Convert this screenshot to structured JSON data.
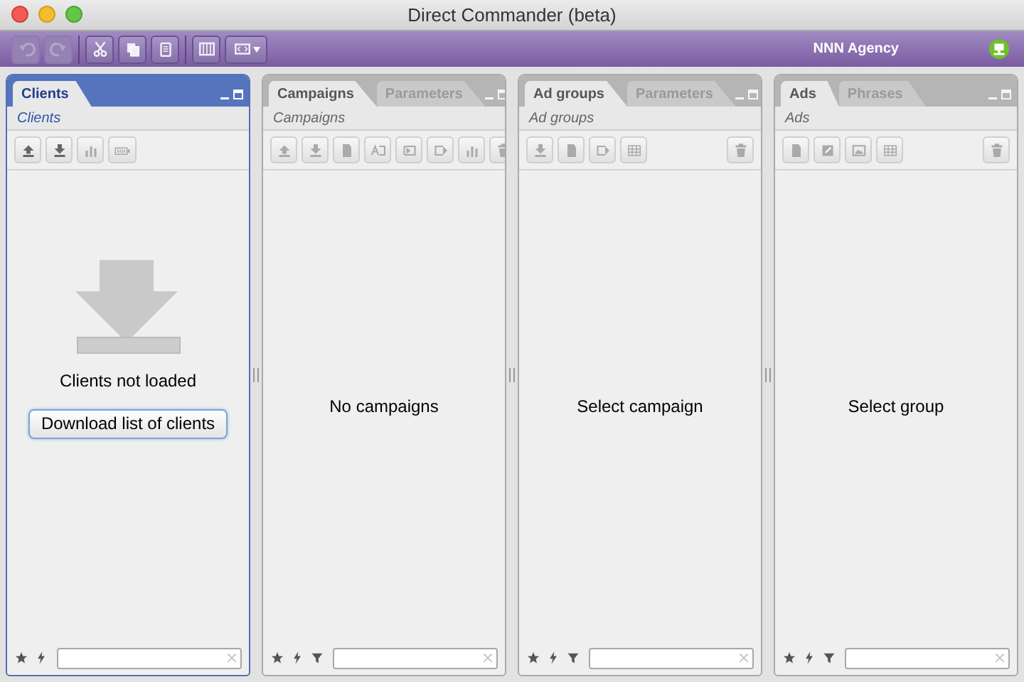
{
  "window": {
    "title": "Direct Commander (beta)"
  },
  "toolbar": {
    "buttons": [
      {
        "kind": "undo",
        "disabled": true
      },
      {
        "kind": "redo",
        "disabled": true
      },
      {
        "kind": "cut",
        "disabled": false
      },
      {
        "kind": "copy",
        "disabled": false
      },
      {
        "kind": "paste",
        "disabled": false
      },
      {
        "kind": "columns",
        "disabled": false
      },
      {
        "kind": "view",
        "disabled": false
      }
    ],
    "account": "NNN Agency"
  },
  "panels": [
    {
      "active": true,
      "tabs": [
        {
          "label": "Clients",
          "selected": true
        }
      ],
      "subtitle": "Clients",
      "tools": [
        {
          "kind": "upload"
        },
        {
          "kind": "download"
        },
        {
          "kind": "chart"
        },
        {
          "kind": "battery"
        }
      ],
      "message": "Clients not loaded",
      "illustration": true,
      "action_button": "Download list of clients",
      "filters": [
        {
          "kind": "star"
        },
        {
          "kind": "bolt"
        }
      ]
    },
    {
      "active": false,
      "tabs": [
        {
          "label": "Campaigns",
          "selected": true
        },
        {
          "label": "Parameters",
          "selected": false
        }
      ],
      "subtitle": "Campaigns",
      "tools": [
        {
          "kind": "upload"
        },
        {
          "kind": "download"
        },
        {
          "kind": "document"
        },
        {
          "kind": "ab"
        },
        {
          "kind": "bracket-in"
        },
        {
          "kind": "bracket-out"
        },
        {
          "kind": "chart"
        },
        {
          "kind": "trash"
        }
      ],
      "message": "No campaigns",
      "filters": [
        {
          "kind": "star"
        },
        {
          "kind": "bolt"
        },
        {
          "kind": "funnel"
        }
      ]
    },
    {
      "active": false,
      "tabs": [
        {
          "label": "Ad groups",
          "selected": true
        },
        {
          "label": "Parameters",
          "selected": false
        }
      ],
      "subtitle": "Ad groups",
      "tools": [
        {
          "kind": "download"
        },
        {
          "kind": "document"
        },
        {
          "kind": "bracket-out"
        },
        {
          "kind": "table"
        },
        {
          "kind": "trash"
        }
      ],
      "message": "Select campaign",
      "filters": [
        {
          "kind": "star"
        },
        {
          "kind": "bolt"
        },
        {
          "kind": "funnel"
        }
      ]
    },
    {
      "active": false,
      "tabs": [
        {
          "label": "Ads",
          "selected": true
        },
        {
          "label": "Phrases",
          "selected": false
        }
      ],
      "subtitle": "Ads",
      "tools": [
        {
          "kind": "document"
        },
        {
          "kind": "edit"
        },
        {
          "kind": "image"
        },
        {
          "kind": "table"
        },
        {
          "kind": "trash"
        }
      ],
      "message": "Select group",
      "filters": [
        {
          "kind": "star"
        },
        {
          "kind": "bolt"
        },
        {
          "kind": "funnel"
        }
      ]
    }
  ]
}
